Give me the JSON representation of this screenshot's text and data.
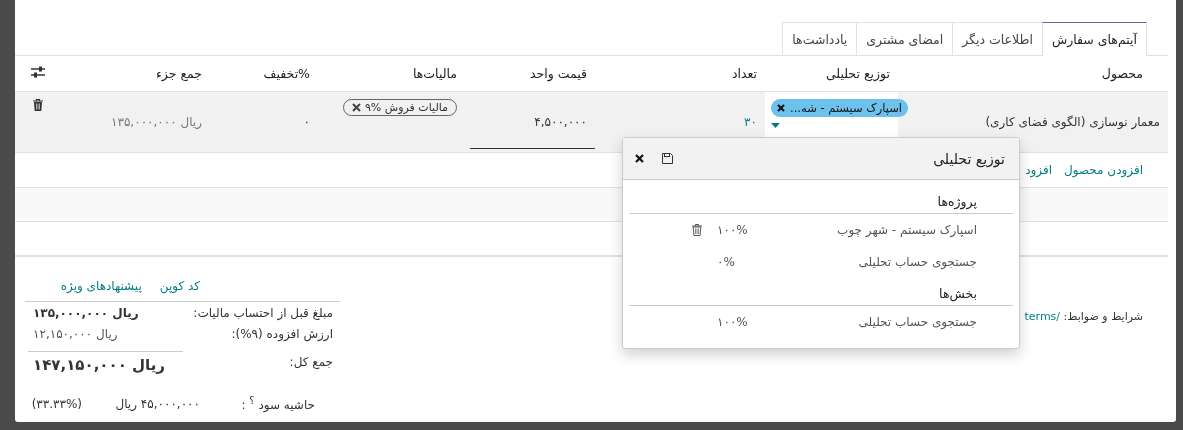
{
  "tabs": [
    {
      "label": "آیتم‌های سفارش",
      "selected": true
    },
    {
      "label": "اطلاعات دیگر",
      "selected": false
    },
    {
      "label": "امضای مشتری",
      "selected": false
    },
    {
      "label": "یادداشت‌ها",
      "selected": false
    }
  ],
  "table": {
    "columns": [
      "محصول",
      "توزیع تحلیلی",
      "تعداد",
      "قیمت واحد",
      "مالیات‌ها",
      "%تخفیف",
      "جمع جزء"
    ],
    "rows": [
      {
        "product": "معمار نوسازی (الگوی فضای کاری)",
        "analytic_tag": "اسپارک سیستم - شه...",
        "quantity": "۳۰",
        "unit_price": "۴,۵۰۰,۰۰۰",
        "tax_tag": "مالیات فروش %۹",
        "discount": "۰",
        "subtotal": "ریال ۱۳۵,۰۰۰,۰۰۰"
      }
    ],
    "add_links": [
      "افزودن محصول",
      "افزود"
    ]
  },
  "analytic_popup": {
    "title": "توزیع تحلیلی",
    "groups": [
      {
        "name": "پروژه‌ها",
        "lines": [
          {
            "account": "اسپارک سیستم - شهر چوب",
            "percentage": "۱۰۰%",
            "deletable": true
          },
          {
            "account": "جستجوی حساب تحلیلی",
            "percentage": "۰%",
            "deletable": false
          }
        ]
      },
      {
        "name": "بخش‌ها",
        "lines": [
          {
            "account": "جستجوی حساب تحلیلی",
            "percentage": "۱۰۰%",
            "deletable": false
          }
        ]
      }
    ]
  },
  "terms": {
    "label": "شرایط و ضوابط:",
    "link": "/terms"
  },
  "totals": {
    "links": [
      "کد کوپن",
      "پیشنهادهای ویژه"
    ],
    "lines": [
      {
        "label": "مبلغ قبل از احتساب مالیات:",
        "value": "ریال ۱۳۵,۰۰۰,۰۰۰",
        "kind": "bold"
      },
      {
        "label": "ارزش افزوده (۹%):",
        "value": "ریال ۱۲,۱۵۰,۰۰۰",
        "kind": "normal"
      },
      {
        "label": "جمع کل:",
        "value": "ریال ۱۴۷,۱۵۰,۰۰۰",
        "kind": "total"
      }
    ],
    "margin": {
      "label": "حاشیه سود $^{؟}$ :",
      "amount": "۴۵,۰۰۰,۰۰۰ ریال",
      "percent": "(۳۳.۳۳%)"
    }
  }
}
